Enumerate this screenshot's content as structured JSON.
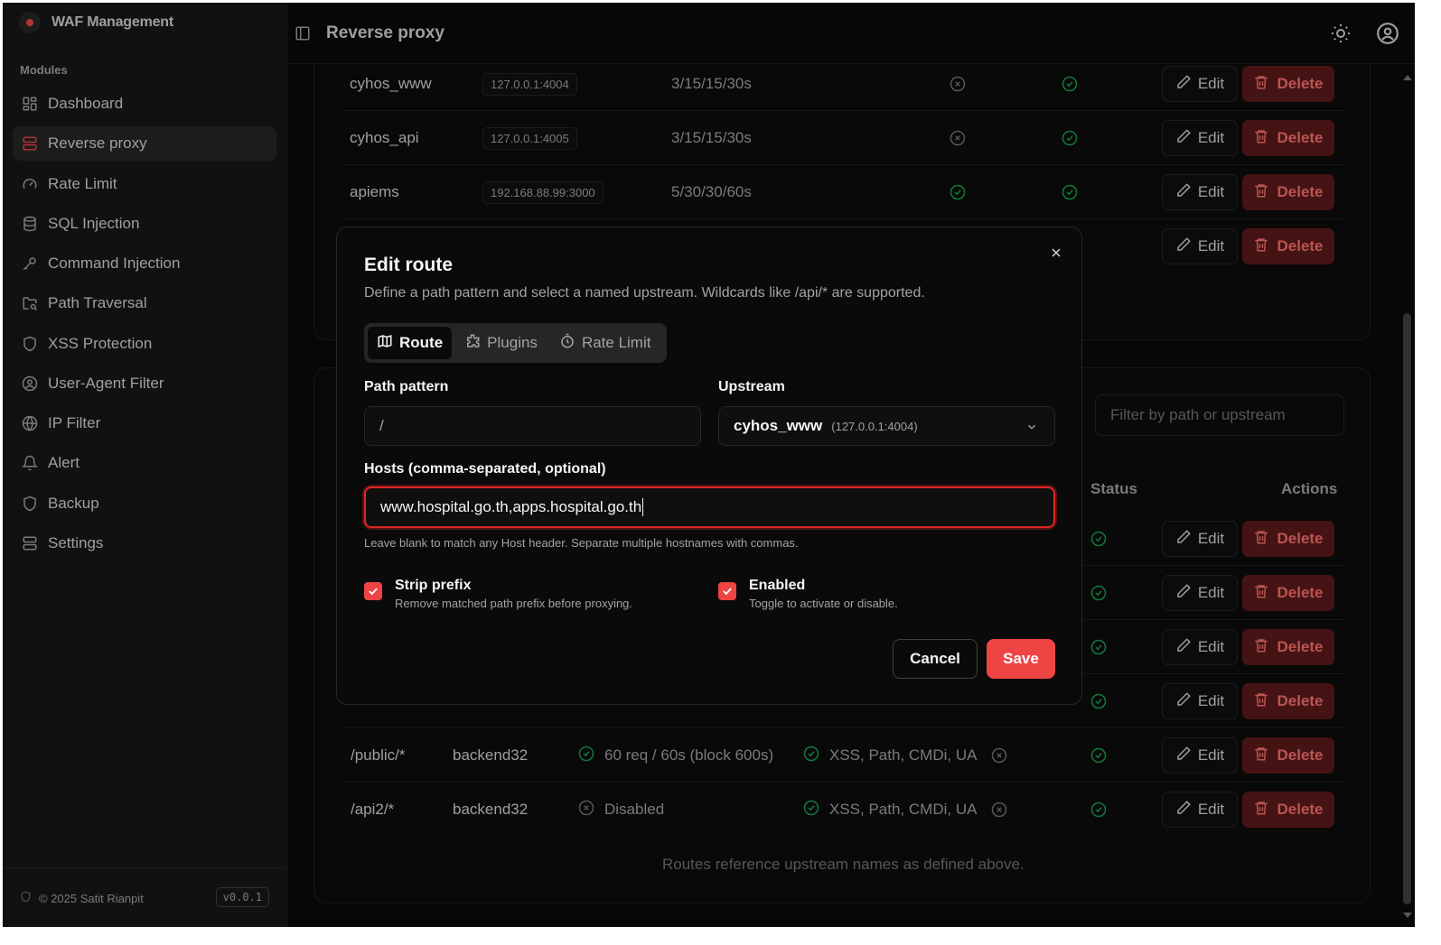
{
  "sidebar": {
    "brand": "WAF Management",
    "section_label": "Modules",
    "items": [
      {
        "label": "Dashboard",
        "icon": "dashboard-icon"
      },
      {
        "label": "Reverse proxy",
        "icon": "server-icon",
        "active": true
      },
      {
        "label": "Rate Limit",
        "icon": "gauge-icon"
      },
      {
        "label": "SQL Injection",
        "icon": "database-icon"
      },
      {
        "label": "Command Injection",
        "icon": "key-icon"
      },
      {
        "label": "Path Traversal",
        "icon": "folder-search-icon"
      },
      {
        "label": "XSS Protection",
        "icon": "shield-icon"
      },
      {
        "label": "User-Agent Filter",
        "icon": "user-circle-icon"
      },
      {
        "label": "IP Filter",
        "icon": "globe-icon"
      },
      {
        "label": "Alert",
        "icon": "bell-icon"
      },
      {
        "label": "Backup",
        "icon": "shield-icon"
      },
      {
        "label": "Settings",
        "icon": "server-icon"
      }
    ],
    "copyright": "© 2025 Satit Rianpit",
    "version": "v0.0.1"
  },
  "header": {
    "title": "Reverse proxy"
  },
  "upstreams": [
    {
      "name": "cyhos_www",
      "address": "127.0.0.1:4004",
      "timeouts": "3/15/15/30s",
      "col_a": "x",
      "col_b": "check"
    },
    {
      "name": "cyhos_api",
      "address": "127.0.0.1:4005",
      "timeouts": "3/15/15/30s",
      "col_a": "x",
      "col_b": "check"
    },
    {
      "name": "apiems",
      "address": "192.168.88.99:3000",
      "timeouts": "5/30/30/60s",
      "col_a": "check",
      "col_b": "check"
    },
    {
      "name": "",
      "address": "",
      "timeouts": "",
      "col_a": "",
      "col_b": ""
    }
  ],
  "routes": {
    "filter_placeholder": "Filter by path or upstream",
    "col_status": "Status",
    "col_actions": "Actions",
    "rows": [
      {
        "path": "",
        "upstream": "",
        "rate": "",
        "plugins": "",
        "strip": "",
        "status": "check"
      },
      {
        "path": "",
        "upstream": "",
        "rate": "",
        "plugins": "",
        "strip": "",
        "status": "check"
      },
      {
        "path": "",
        "upstream": "",
        "rate": "",
        "plugins": "",
        "strip": "",
        "status": "check"
      },
      {
        "path": "",
        "upstream": "",
        "rate": "",
        "plugins": "",
        "strip": "",
        "status": "check"
      },
      {
        "path": "/public/*",
        "upstream": "backend32",
        "rate": "60 req / 60s (block 600s)",
        "rate_icon": "check",
        "plugins": "XSS, Path, CMDi, UA",
        "strip": "x",
        "status": "check"
      },
      {
        "path": "/api2/*",
        "upstream": "backend32",
        "rate": "Disabled",
        "rate_icon": "x",
        "plugins": "XSS, Path, CMDi, UA",
        "strip": "x",
        "status": "check"
      }
    ],
    "footnote": "Routes reference upstream names as defined above."
  },
  "actions": {
    "edit": "Edit",
    "delete": "Delete"
  },
  "modal": {
    "title": "Edit route",
    "description": "Define a path pattern and select a named upstream. Wildcards like /api/* are supported.",
    "tabs": [
      {
        "label": "Route",
        "icon": "map-icon",
        "active": true
      },
      {
        "label": "Plugins",
        "icon": "puzzle-icon"
      },
      {
        "label": "Rate Limit",
        "icon": "timer-icon"
      }
    ],
    "path_label": "Path pattern",
    "path_value": "/",
    "upstream_label": "Upstream",
    "upstream_value": "cyhos_www",
    "upstream_address": "(127.0.0.1:4004)",
    "hosts_label": "Hosts (comma-separated, optional)",
    "hosts_value": "www.hospital.go.th,apps.hospital.go.th",
    "hosts_help": "Leave blank to match any Host header. Separate multiple hostnames with commas.",
    "strip_label": "Strip prefix",
    "strip_desc": "Remove matched path prefix before proxying.",
    "strip_checked": true,
    "enabled_label": "Enabled",
    "enabled_desc": "Toggle to activate or disable.",
    "enabled_checked": true,
    "cancel": "Cancel",
    "save": "Save"
  },
  "colors": {
    "accent": "#ef4444",
    "success": "#16a34a",
    "muted": "#737373"
  }
}
